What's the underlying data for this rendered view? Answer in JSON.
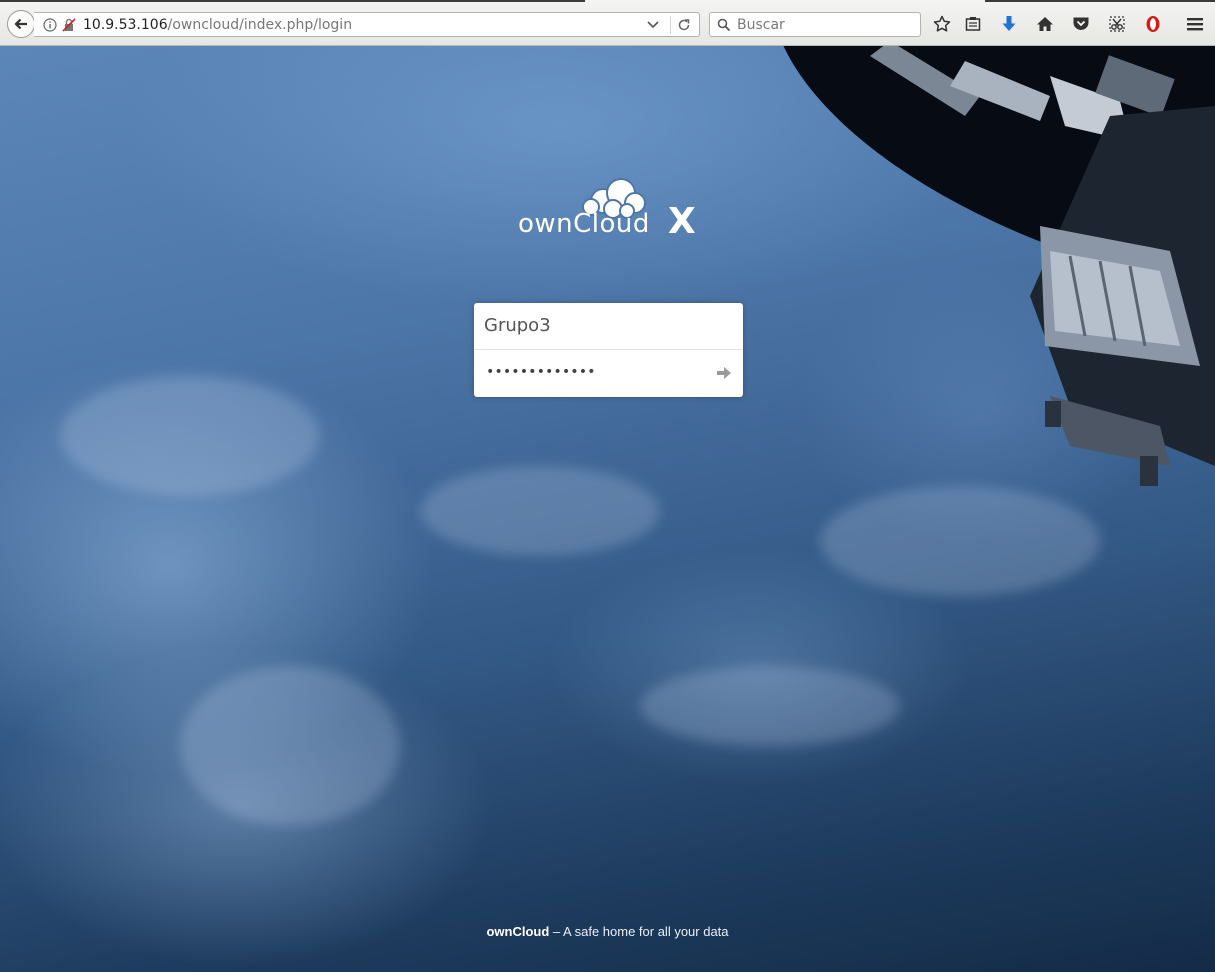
{
  "browser": {
    "url_host": "10.9.53.106",
    "url_path": "/owncloud/index.php/login",
    "search_placeholder": "Buscar"
  },
  "logo": {
    "brand": "ownCloud",
    "version_mark": "X"
  },
  "login": {
    "username": "Grupo3",
    "password_mask": "•••••••••••••"
  },
  "footer": {
    "brand": "ownCloud",
    "tagline": " – A safe home for all your data"
  },
  "icons": {
    "back": "back-arrow-icon",
    "info": "info-icon",
    "insecure": "insecure-lock-icon",
    "dropdown": "chevron-down-icon",
    "reload": "reload-icon",
    "search": "search-icon",
    "bookmark": "star-icon",
    "reading_list": "clipboard-icon",
    "downloads": "download-icon",
    "home": "home-icon",
    "pocket": "pocket-icon",
    "screenshot": "scissors-icon",
    "opera": "opera-icon",
    "menu": "hamburger-icon",
    "submit": "arrow-right-icon"
  },
  "colors": {
    "download_arrow": "#1f72d6",
    "opera_red": "#d61a1a"
  }
}
